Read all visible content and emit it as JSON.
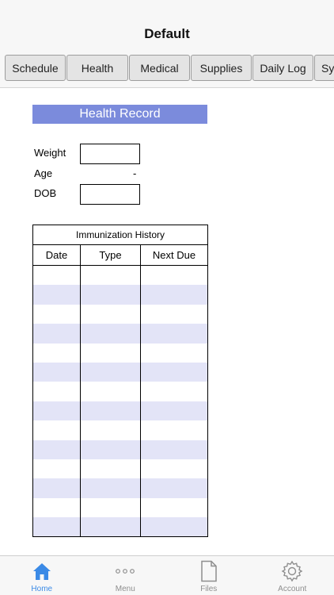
{
  "navbar": {
    "title": "Default"
  },
  "tabs": [
    {
      "label": "Schedule"
    },
    {
      "label": "Health"
    },
    {
      "label": "Medical"
    },
    {
      "label": "Supplies"
    },
    {
      "label": "Daily Log"
    },
    {
      "label": "Sy"
    }
  ],
  "health": {
    "header": "Health Record",
    "weight_label": "Weight",
    "weight_value": "",
    "age_label": "Age",
    "age_value": "-",
    "dob_label": "DOB",
    "dob_value": ""
  },
  "immunization": {
    "title": "Immunization History",
    "columns": [
      "Date",
      "Type",
      "Next Due"
    ],
    "rows": 14,
    "stripe_color": "#e3e4f7"
  },
  "colors": {
    "accent": "#3b8ae6",
    "header_bg": "#7b8bdc"
  },
  "tabbar": [
    {
      "label": "Home",
      "icon": "home-icon",
      "active": true
    },
    {
      "label": "Menu",
      "icon": "more-dots-icon",
      "active": false
    },
    {
      "label": "Files",
      "icon": "file-icon",
      "active": false
    },
    {
      "label": "Account",
      "icon": "gear-icon",
      "active": false
    }
  ]
}
